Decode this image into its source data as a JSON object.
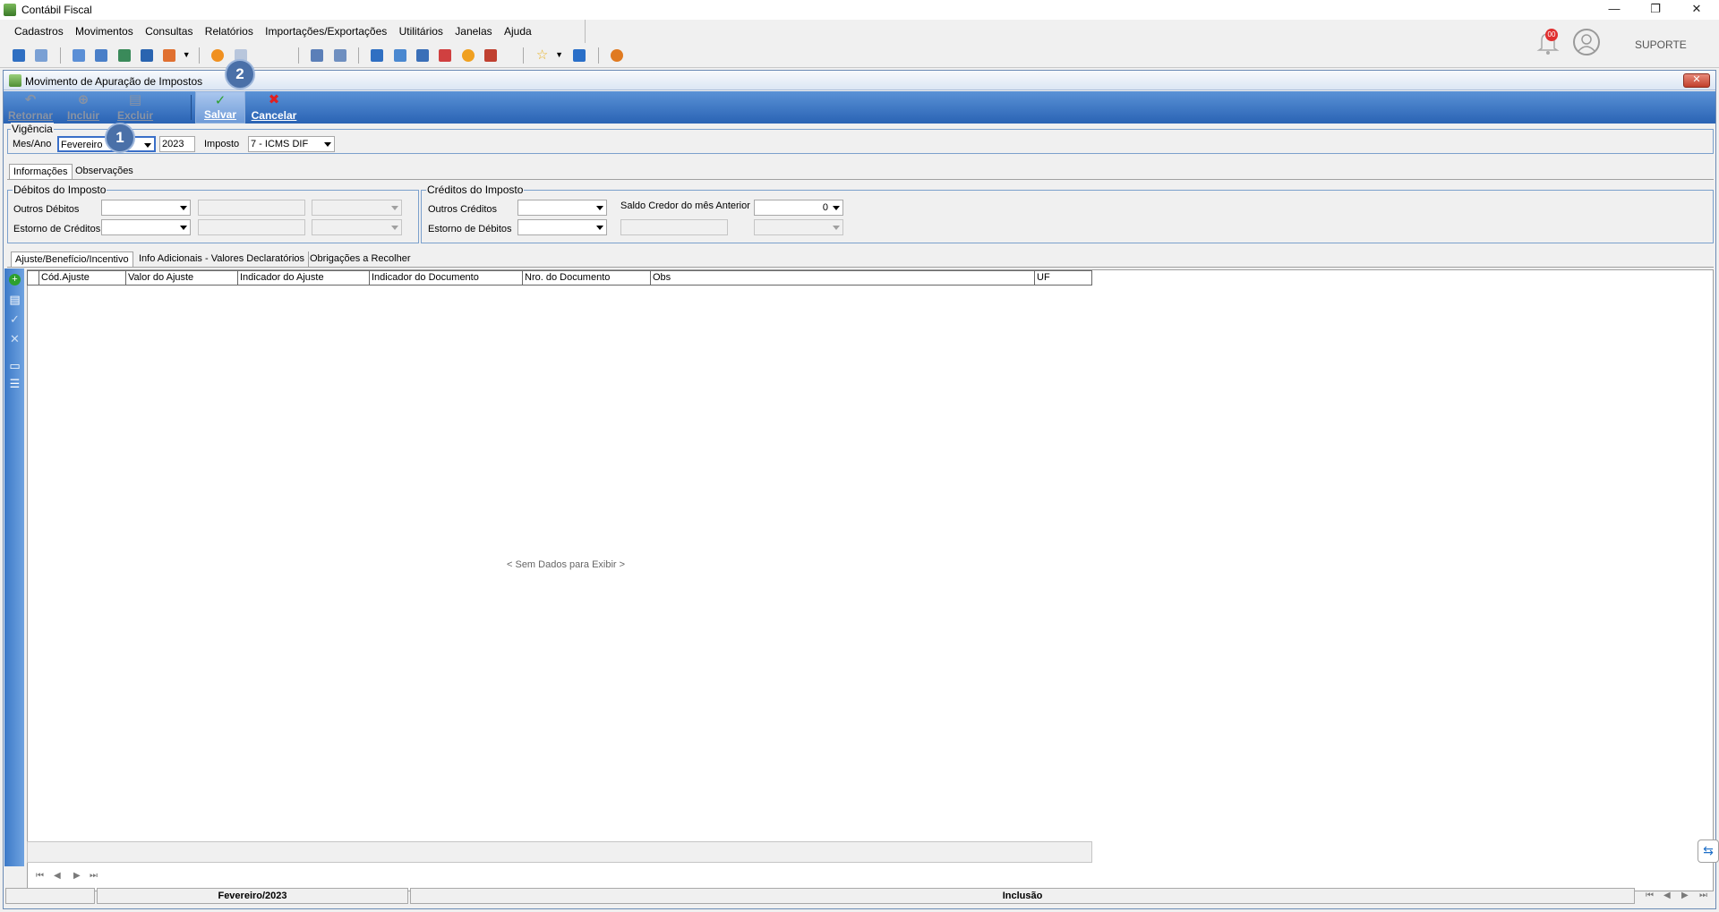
{
  "window": {
    "title": "Contábil Fiscal"
  },
  "menu": [
    "Cadastros",
    "Movimentos",
    "Consultas",
    "Relatórios",
    "Importações/Exportações",
    "Utilitários",
    "Janelas",
    "Ajuda"
  ],
  "notifications": {
    "count": "00"
  },
  "user": {
    "label": "SUPORTE"
  },
  "child": {
    "title": "Movimento de Apuração de Impostos",
    "buttons": {
      "retornar": "Retornar",
      "incluir": "Incluir",
      "excluir": "Excluir",
      "salvar": "Salvar",
      "cancelar": "Cancelar"
    }
  },
  "badges": {
    "one": "1",
    "two": "2"
  },
  "vigencia": {
    "title": "Vigência",
    "mesano_label": "Mes/Ano",
    "month": "Fevereiro",
    "year": "2023",
    "imposto_label": "Imposto",
    "imposto": "7 - ICMS DIF"
  },
  "tabs_main": [
    "Informações",
    "Observações"
  ],
  "debitos": {
    "title": "Débitos do Imposto",
    "outros_debitos": "Outros Débitos",
    "estorno_creditos": "Estorno de Créditos"
  },
  "creditos": {
    "title": "Créditos do Imposto",
    "outros_creditos": "Outros Créditos",
    "estorno_debitos": "Estorno de Débitos",
    "saldo_label": "Saldo Credor do mês Anterior",
    "saldo_value": "0"
  },
  "tabs_sub": [
    "Ajuste/Benefício/Incentivo",
    "Info Adicionais - Valores Declaratórios",
    "Obrigações a Recolher"
  ],
  "grid": {
    "columns": [
      "Cód.Ajuste",
      "Valor do Ajuste",
      "Indicador do Ajuste",
      "Indicador do Documento",
      "Nro. do Documento",
      "Obs",
      "UF"
    ],
    "empty": "< Sem Dados para Exibir >"
  },
  "status": {
    "period": "Fevereiro/2023",
    "mode": "Inclusão"
  }
}
